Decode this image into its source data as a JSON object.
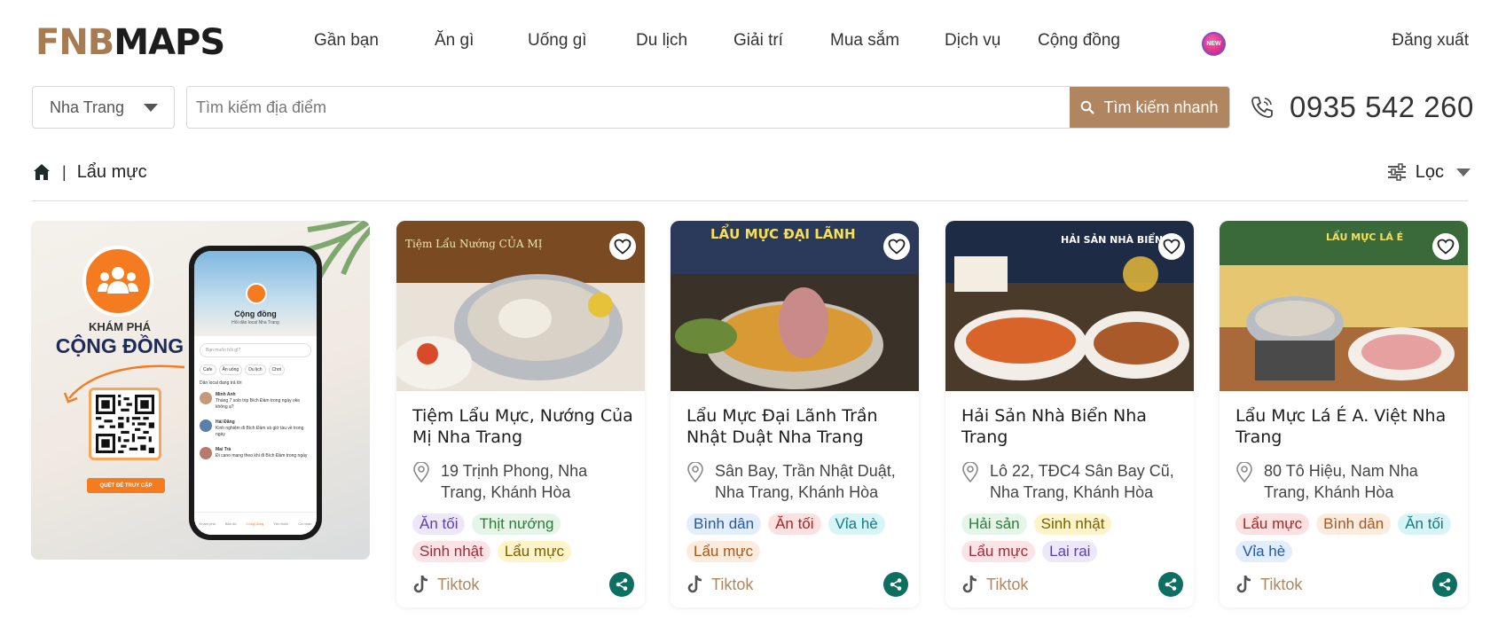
{
  "header": {
    "logo_part1": "FNB",
    "logo_part2": "MAPS",
    "nav": [
      "Gần bạn",
      "Ăn gì",
      "Uống gì",
      "Du lịch",
      "Giải trí",
      "Mua sắm",
      "Dịch vụ",
      "Cộng đồng"
    ],
    "new_badge": "NEW",
    "logout": "Đăng xuất"
  },
  "search": {
    "city": "Nha Trang",
    "placeholder": "Tìm kiếm địa điểm",
    "value": "",
    "button_label": "Tìm kiếm nhanh",
    "phone": "0935 542 260"
  },
  "breadcrumb": {
    "separator": "|",
    "current": "Lẩu mực"
  },
  "filter_label": "Lọc",
  "promo": {
    "kicker": "KHÁM PHÁ",
    "title": "CỘNG ĐỒNG",
    "qr_button": "QUÉT ĐỂ TRUY CẬP",
    "app_title": "Cộng đồng",
    "app_subtitle": "Hỏi dân local Nha Trang",
    "app_search": "Bạn muốn hỏi gì?",
    "app_chips": [
      "Cafe",
      "Ăn uống",
      "Du lịch",
      "Chơi"
    ],
    "app_section": "Dân local đang trả lời",
    "app_posts": [
      {
        "name": "Minh Anh",
        "text": "Tháng 7 solo trip Bích Đầm trong ngày oke không ạ?"
      },
      {
        "name": "Hải Đăng",
        "text": "Kinh nghiệm đi Bích Đầm và giờ tàu về trong ngày"
      },
      {
        "name": "Mai Trà",
        "text": "Đi cano mang theo khi đi Bích Đầm trong ngày"
      }
    ],
    "app_nav": [
      "Khám phá",
      "Bản đồ",
      "Cộng đồng",
      "Yêu thích",
      "Cá nhân"
    ]
  },
  "cards": [
    {
      "title": "Tiệm Lẩu Mực, Nướng Của Mị Nha Trang",
      "address": "19 Trịnh Phong, Nha Trang, Khánh Hòa",
      "tags": [
        {
          "label": "Ăn tối",
          "color": "purple"
        },
        {
          "label": "Thịt nướng",
          "color": "green"
        },
        {
          "label": "Sinh nhật",
          "color": "pink"
        },
        {
          "label": "Lẩu mực",
          "color": "yellow"
        }
      ],
      "social": "Tiktok",
      "image_sign": "Tiệm Lẩu Nướng CỦA MỊ"
    },
    {
      "title": "Lẩu Mực Đại Lãnh Trần Nhật Duật Nha Trang",
      "address": "Sân Bay, Trần Nhật Duật, Nha Trang, Khánh Hòa",
      "tags": [
        {
          "label": "Bình dân",
          "color": "blue"
        },
        {
          "label": "Ăn tối",
          "color": "red"
        },
        {
          "label": "Vỉa hè",
          "color": "cyan"
        },
        {
          "label": "Lẩu mực",
          "color": "orange"
        }
      ],
      "social": "Tiktok",
      "image_sign": "LẨU MỰC ĐẠI LÃNH"
    },
    {
      "title": "Hải Sản Nhà Biển Nha Trang",
      "address": "Lô 22, TĐC4 Sân Bay Cũ, Nha Trang, Khánh Hòa",
      "tags": [
        {
          "label": "Hải sản",
          "color": "green"
        },
        {
          "label": "Sinh nhật",
          "color": "yellow"
        },
        {
          "label": "Lẩu mực",
          "color": "pink"
        },
        {
          "label": "Lai rai",
          "color": "purple"
        }
      ],
      "social": "Tiktok",
      "image_sign": "HẢI SẢN NHÀ BIỂN"
    },
    {
      "title": "Lẩu Mực Lá É A. Việt Nha Trang",
      "address": "80 Tô Hiệu, Nam Nha Trang, Khánh Hòa",
      "tags": [
        {
          "label": "Lẩu mực",
          "color": "red"
        },
        {
          "label": "Bình dân",
          "color": "orange"
        },
        {
          "label": "Ăn tối",
          "color": "cyan"
        },
        {
          "label": "Vỉa hè",
          "color": "blue"
        }
      ],
      "social": "Tiktok",
      "image_sign": "LẨU MỰC LÁ É"
    }
  ],
  "colors": {
    "brand_brown": "#b08660",
    "share_green": "#0d6e62",
    "promo_orange": "#f47b20"
  }
}
